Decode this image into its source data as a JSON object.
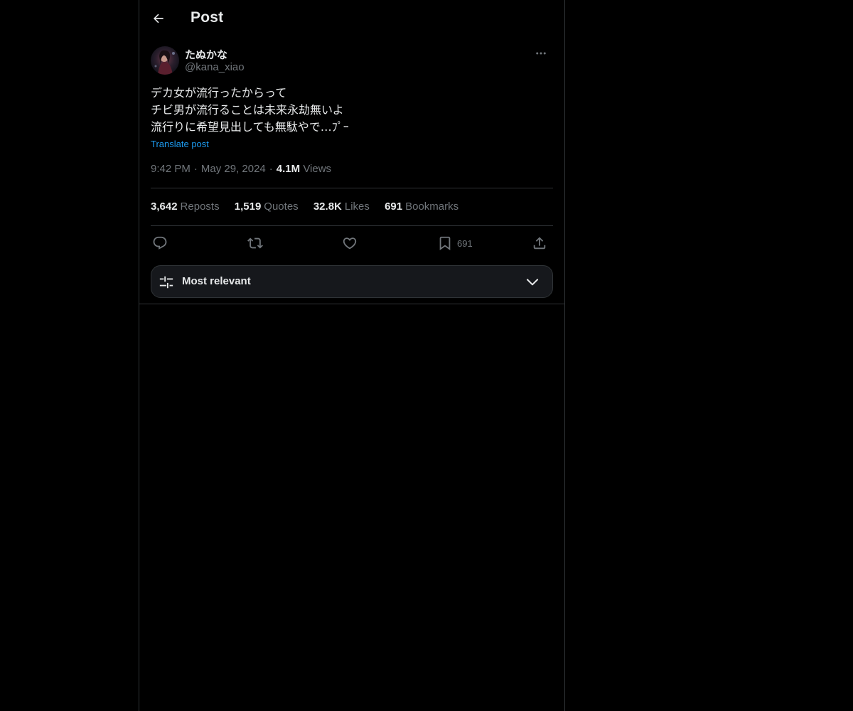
{
  "header": {
    "title": "Post",
    "back_icon": "arrow-left-icon"
  },
  "author": {
    "display_name": "たぬかな",
    "handle": "@kana_xiao",
    "more_icon": "more-horizontal-icon"
  },
  "tweet": {
    "lines": [
      "デカ女が流行ったからって",
      "チビ男が流行ることは未来永劫無いよ",
      "流行りに希望見出しても無駄やで…ﾌﾟｰ"
    ],
    "translate_label": "Translate post",
    "time": "9:42 PM",
    "date": "May 29, 2024",
    "separator": "·",
    "views_count": "4.1M",
    "views_label": "Views"
  },
  "stats": {
    "reposts_count": "3,642",
    "reposts_label": "Reposts",
    "quotes_count": "1,519",
    "quotes_label": "Quotes",
    "likes_count": "32.8K",
    "likes_label": "Likes",
    "bookmarks_count": "691",
    "bookmarks_label": "Bookmarks"
  },
  "actions": {
    "reply_icon": "reply-icon",
    "repost_icon": "repost-icon",
    "like_icon": "heart-icon",
    "bookmark_icon": "bookmark-icon",
    "bookmark_count": "691",
    "share_icon": "share-icon"
  },
  "sort": {
    "label": "Most relevant",
    "icon": "sliders-icon",
    "chevron": "chevron-down-icon"
  },
  "colors": {
    "background": "#000000",
    "text_primary": "#e7e9ea",
    "text_secondary": "#71767b",
    "accent": "#1d9bf0",
    "border": "#2f3336"
  }
}
